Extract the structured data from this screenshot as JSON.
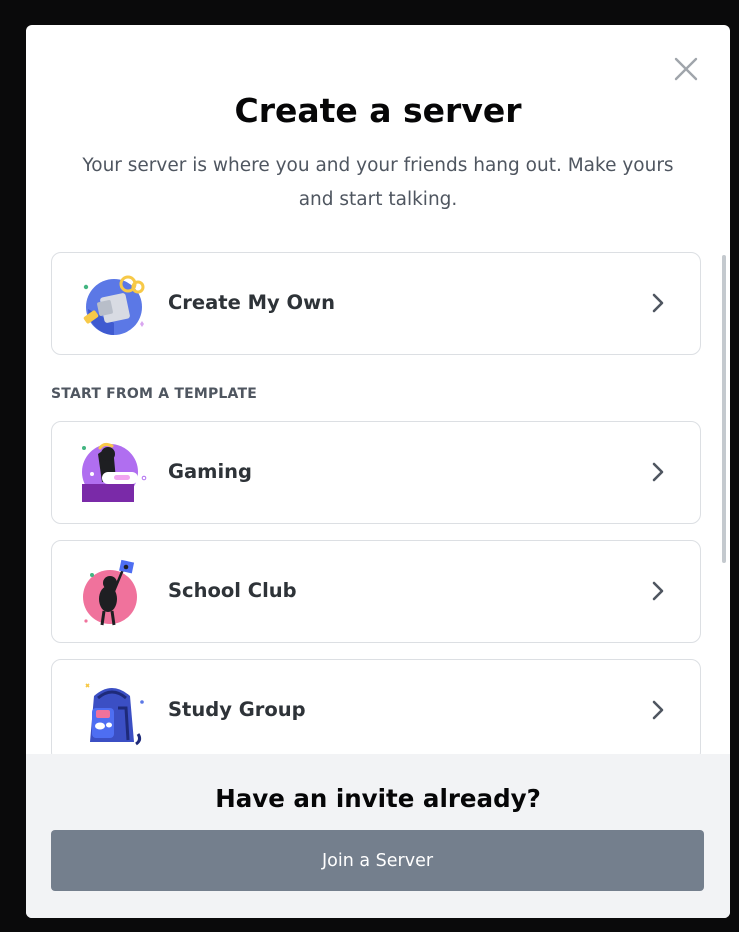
{
  "modal": {
    "title": "Create a server",
    "subtitle": "Your server is where you and your friends hang out. Make yours and start talking.",
    "close_icon": "close-icon"
  },
  "create_own": {
    "label": "Create My Own",
    "icon": "create-my-own-illustration"
  },
  "templates": {
    "header": "START FROM A TEMPLATE",
    "items": [
      {
        "label": "Gaming",
        "icon": "gaming-illustration"
      },
      {
        "label": "School Club",
        "icon": "school-club-illustration"
      },
      {
        "label": "Study Group",
        "icon": "study-group-illustration"
      }
    ]
  },
  "footer": {
    "title": "Have an invite already?",
    "join_label": "Join a Server"
  },
  "colors": {
    "join_button": "#747f8d",
    "footer_bg": "#f2f3f5",
    "card_border": "#dcdfe3",
    "title_text": "#060607",
    "body_text": "#4f5660"
  }
}
